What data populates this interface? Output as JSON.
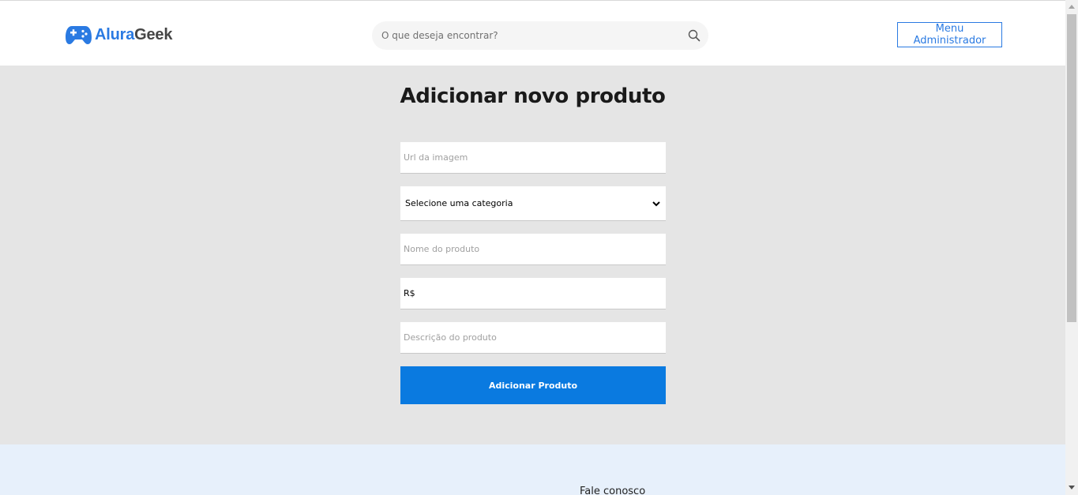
{
  "header": {
    "logo": {
      "part1": "Alura",
      "part2": "Geek",
      "icon": "gamepad-icon"
    },
    "search": {
      "placeholder": "O que deseja encontrar?",
      "value": "",
      "icon": "search-icon"
    },
    "admin_button": "Menu Administrador"
  },
  "main": {
    "title": "Adicionar novo produto",
    "form": {
      "url_placeholder": "Url da imagem",
      "category_selected": "Selecione uma categoria",
      "name_placeholder": "Nome do produto",
      "price_value": "R$",
      "description_placeholder": "Descrição do produto",
      "submit_label": "Adicionar Produto"
    }
  },
  "footer": {
    "contact_title": "Fale conosco"
  },
  "colors": {
    "brand_blue": "#2a7ae2",
    "button_blue": "#0a7ae0",
    "main_bg": "#e5e5e5",
    "footer_bg": "#e7f0fb"
  }
}
